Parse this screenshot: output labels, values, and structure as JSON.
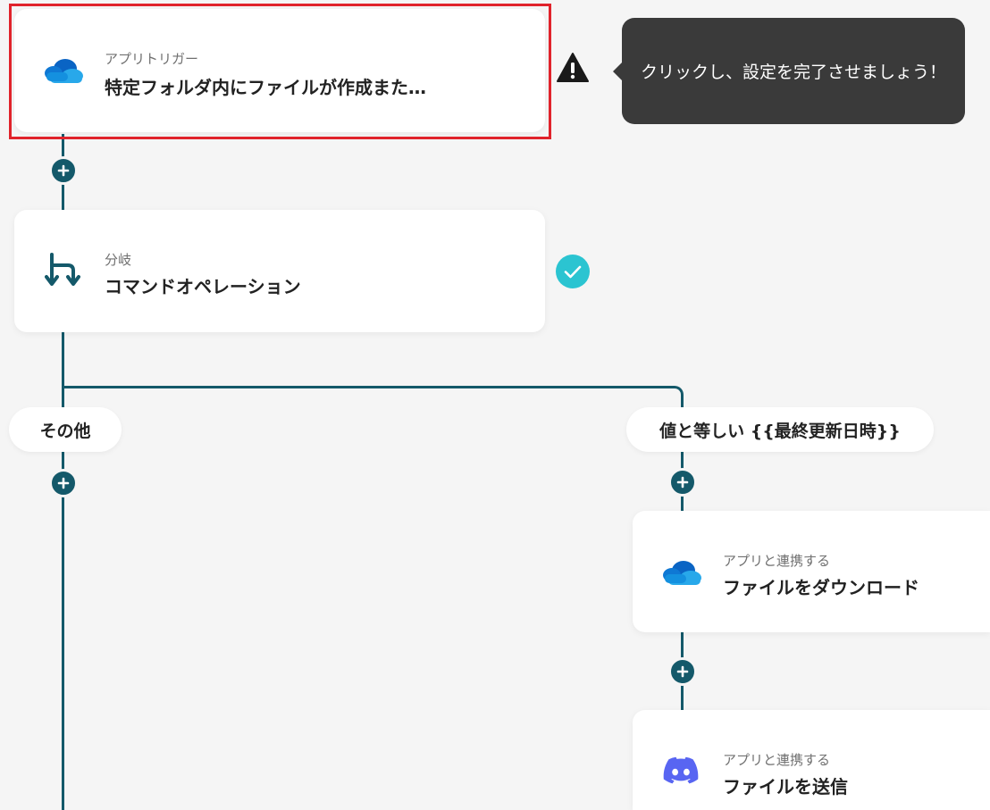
{
  "flow": {
    "trigger": {
      "sub": "アプリトリガー",
      "title": "特定フォルダ内にファイルが作成また…",
      "icon": "onedrive-icon",
      "status": "warning-icon"
    },
    "tooltip": "クリックし、設定を完了させましょう！",
    "branch": {
      "sub": "分岐",
      "title": "コマンドオペレーション",
      "icon": "branch-icon",
      "status": "check-icon"
    },
    "branch_labels": {
      "left": "その他",
      "right": "値と等しい {{最終更新日時}}"
    },
    "download": {
      "sub": "アプリと連携する",
      "title": "ファイルをダウンロード",
      "icon": "onedrive-icon"
    },
    "send": {
      "sub": "アプリと連携する",
      "title": "ファイルを送信",
      "icon": "discord-icon"
    }
  },
  "colors": {
    "connector": "#14596a",
    "selected": "#e0232b",
    "tooltip_bg": "#3a3a3a",
    "check": "#2bc4d1",
    "discord": "#5865f2"
  }
}
